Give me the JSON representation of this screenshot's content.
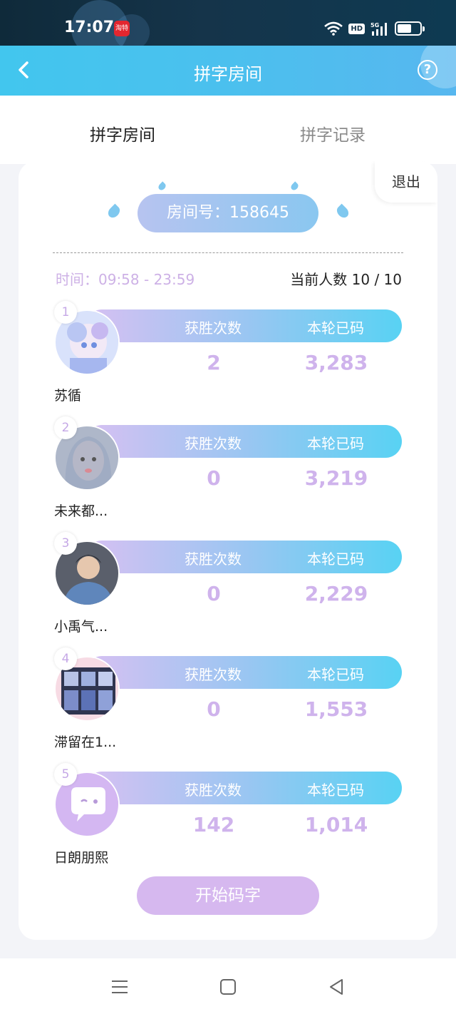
{
  "status_bar": {
    "time": "17:07",
    "app_badge": "淘特",
    "hd": "HD",
    "network": "5G"
  },
  "nav": {
    "title": "拼字房间",
    "help_symbol": "?"
  },
  "tabs": [
    {
      "label": "拼字房间"
    },
    {
      "label": "拼字记录"
    }
  ],
  "room": {
    "exit_label": "退出",
    "room_number_text": "房间号：158645",
    "time_text": "时间：09:58 - 23:59",
    "count_text": "当前人数 10 / 10"
  },
  "stat_labels": {
    "wins": "获胜次数",
    "typed": "本轮已码"
  },
  "players": [
    {
      "rank": "1",
      "name": "苏循",
      "wins": "2",
      "typed": "3,283"
    },
    {
      "rank": "2",
      "name": "未来都...",
      "wins": "0",
      "typed": "3,219"
    },
    {
      "rank": "3",
      "name": "小禹气...",
      "wins": "0",
      "typed": "2,229"
    },
    {
      "rank": "4",
      "name": "滞留在1...",
      "wins": "0",
      "typed": "1,553"
    },
    {
      "rank": "5",
      "name": "日朗朋熙",
      "wins": "142",
      "typed": "1,014"
    }
  ],
  "start_button": "开始码字",
  "colors": {
    "accent": "#4bc6ee",
    "stat_purple": "#cfb3ec",
    "button_purple": "#d6b8ef"
  }
}
